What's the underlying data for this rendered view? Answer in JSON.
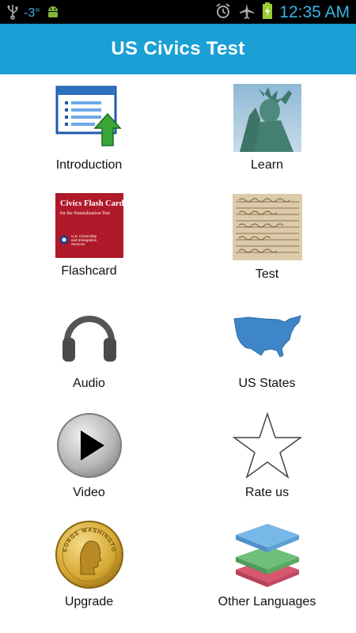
{
  "status_bar": {
    "temperature": "-3°",
    "clock": "12:35 AM",
    "icons": [
      "usb-icon",
      "android-icon",
      "alarm-icon",
      "airplane-icon",
      "battery-charging-icon"
    ]
  },
  "app_bar": {
    "title": "US Civics Test"
  },
  "menu": [
    {
      "label": "Introduction",
      "icon": "document-upload-icon"
    },
    {
      "label": "Learn",
      "icon": "statue-of-liberty-icon"
    },
    {
      "label": "Flashcard",
      "icon": "flash-cards-icon"
    },
    {
      "label": "Test",
      "icon": "old-document-icon"
    },
    {
      "label": "Audio",
      "icon": "headphones-icon"
    },
    {
      "label": "US States",
      "icon": "us-map-icon"
    },
    {
      "label": "Video",
      "icon": "play-icon"
    },
    {
      "label": "Rate us",
      "icon": "star-icon"
    },
    {
      "label": "Upgrade",
      "icon": "gold-coin-icon"
    },
    {
      "label": "Other Languages",
      "icon": "layers-icon"
    }
  ],
  "flashcard_image": {
    "title": "Civics Flash Cards",
    "subtitle": "for the Naturalization Test",
    "agency": "U.S. Citizenship and Immigration Services"
  },
  "coin_text": "GEORGE WASHINGTON",
  "colors": {
    "status_bar_bg": "#000000",
    "status_accent": "#33b5e5",
    "app_bar_bg": "#1aa0d4",
    "flashcard_red": "#b0192a",
    "map_blue": "#3f86c9",
    "coin_gold": "#d4a832"
  }
}
